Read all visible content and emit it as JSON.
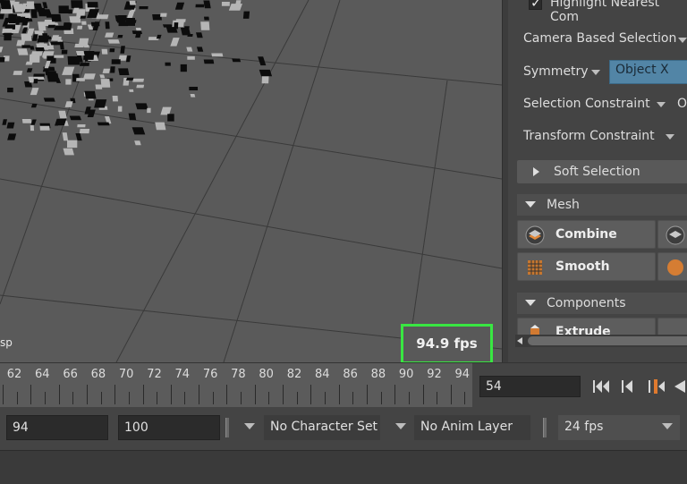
{
  "viewport": {
    "camera_label": "sp",
    "fps_hud": "94.9 fps"
  },
  "panel": {
    "highlight_nearest": "Highlight Nearest Com",
    "camera_based_selection": "Camera Based Selection",
    "symmetry": "Symmetry",
    "symmetry_value": "Object X",
    "selection_constraint": "Selection Constraint",
    "selection_constraint_value": "O",
    "transform_constraint": "Transform Constraint",
    "soft_selection": "Soft Selection",
    "mesh_section": "Mesh",
    "combine": "Combine",
    "smooth": "Smooth",
    "components_section": "Components",
    "extrude": "Extrude"
  },
  "timeline": {
    "ticks": [
      "62",
      "64",
      "66",
      "68",
      "70",
      "72",
      "74",
      "76",
      "78",
      "80",
      "82",
      "84",
      "86",
      "88",
      "90",
      "92",
      "94"
    ],
    "current_frame": "54"
  },
  "range": {
    "start": "94",
    "end": "100",
    "character_set": "No Character Set",
    "anim_layer": "No Anim Layer",
    "fps": "24 fps"
  },
  "colors": {
    "fps_box_border": "#39e642",
    "symmetry_field": "#5285a6",
    "playhead": "#e07a2e"
  }
}
